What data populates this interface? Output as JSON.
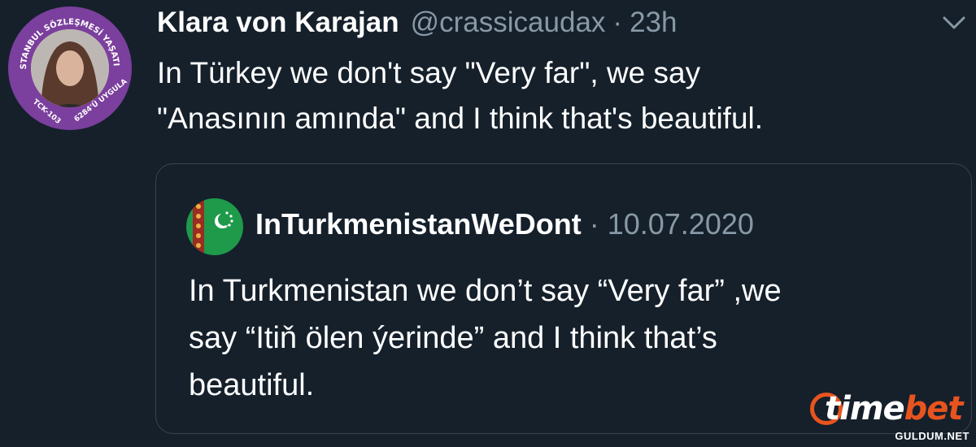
{
  "tweet": {
    "display_name": "Klara von Karajan",
    "handle": "@crassicaudax",
    "separator": "·",
    "time": "23h",
    "text_lines": [
      "In Türkey we don't say \"Very far\", we say",
      "\"Anasının amında\" and I think that's beautiful."
    ],
    "avatar_frame": {
      "top_text": "İSTANBUL SÖZLEŞMESİ YAŞATIR",
      "bottom_left": "TCK-103",
      "bottom_right": "6284'Ü UYGULA",
      "color": "#7b3f9d"
    },
    "menu_icon": "chevron-down-icon"
  },
  "quoted_tweet": {
    "display_name": "InTurkmenistanWeDont",
    "separator": "·",
    "date": "10.07.2020",
    "text_lines": [
      "In Turkmenistan we don’t say “Very far” ,we",
      "say “Itiň ölen ýerinde” and I think that’s",
      "beautiful."
    ],
    "avatar_icon": "turkmenistan-flag-icon"
  },
  "watermark": {
    "logo_time": "time",
    "logo_bet": "bet",
    "site": "GULDUM.NET",
    "accent": "#e8541e"
  },
  "colors": {
    "background": "#15202b",
    "text": "#ffffff",
    "muted": "#8899a6",
    "border": "#38444d"
  }
}
